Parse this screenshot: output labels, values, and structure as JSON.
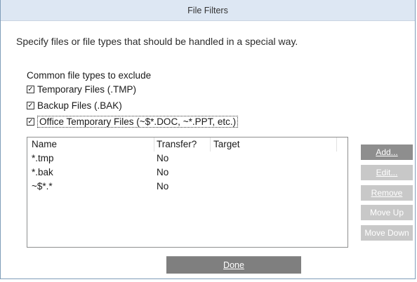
{
  "window": {
    "title": "File Filters"
  },
  "intro": "Specify files or file types that should be handled in a special way.",
  "common": {
    "label": "Common file types to exclude",
    "options": [
      {
        "label": "Temporary Files (.TMP)",
        "checked": true
      },
      {
        "label": "Backup Files (.BAK)",
        "checked": true
      },
      {
        "label": "Office Temporary Files (~$*.DOC, ~*.PPT, etc.)",
        "checked": true
      }
    ]
  },
  "list": {
    "columns": [
      "Name",
      "Transfer?",
      "Target"
    ],
    "rows": [
      {
        "name": "*.tmp",
        "transfer": "No",
        "target": ""
      },
      {
        "name": "*.bak",
        "transfer": "No",
        "target": ""
      },
      {
        "name": "~$*.*",
        "transfer": "No",
        "target": ""
      }
    ]
  },
  "buttons": {
    "add": {
      "label": "Add...",
      "enabled": true
    },
    "edit": {
      "label": "Edit...",
      "enabled": false
    },
    "remove": {
      "label": "Remove",
      "enabled": false
    },
    "move_up": {
      "label": "Move Up",
      "enabled": false
    },
    "move_down": {
      "label": "Move Down",
      "enabled": false
    },
    "done": {
      "label": "Done",
      "enabled": true
    }
  },
  "check_glyph": "✓"
}
